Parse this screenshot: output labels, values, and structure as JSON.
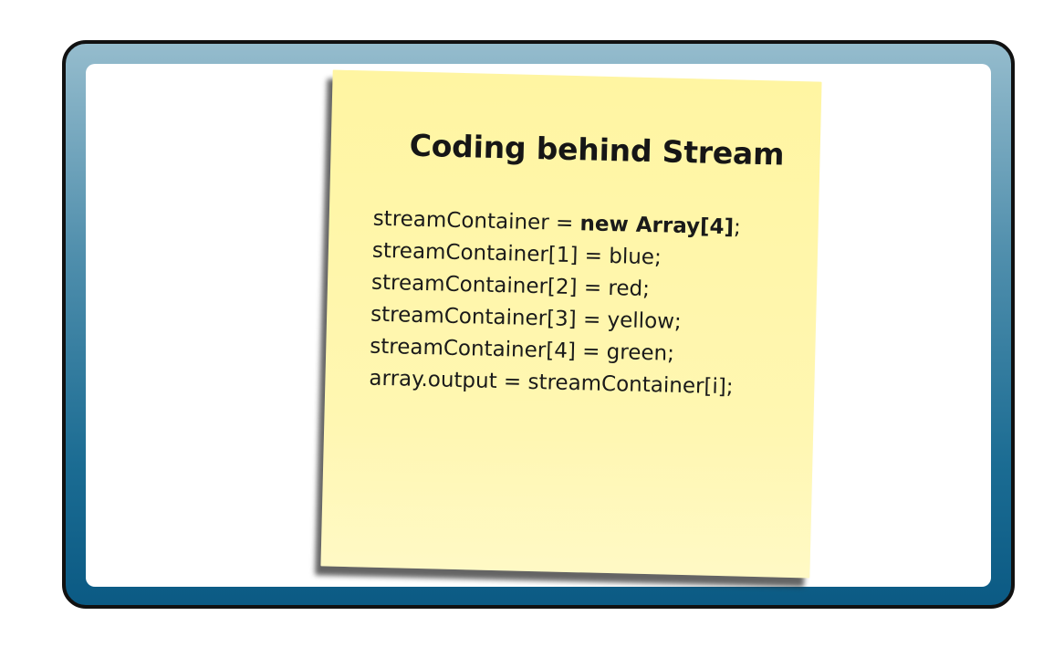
{
  "note": {
    "title": "Coding behind Stream",
    "lines": [
      {
        "prefix": "streamContainer = ",
        "bold": "new Array[4]",
        "suffix": ";"
      },
      {
        "text": "streamContainer[1] = blue;"
      },
      {
        "text": "streamContainer[2] = red;"
      },
      {
        "text": "streamContainer[3] = yellow;"
      },
      {
        "text": "streamContainer[4] = green;"
      },
      {
        "text": "array.output = streamContainer[i];"
      }
    ]
  },
  "colors": {
    "frame_border": "#111111",
    "frame_gradient_top": "#95bccd",
    "frame_gradient_bottom": "#0b5a84",
    "note_background": "#fff6ab",
    "text": "#1a1a1a"
  }
}
